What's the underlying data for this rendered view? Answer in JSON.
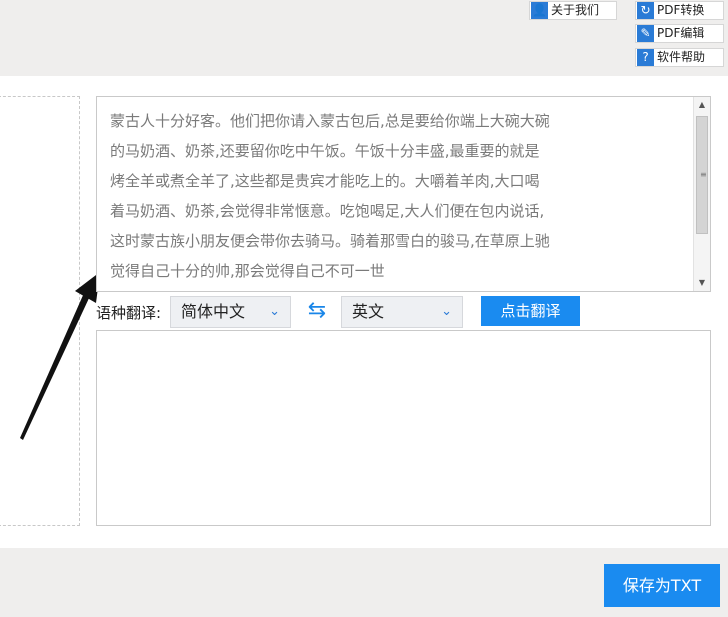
{
  "header": {
    "about": {
      "label": "关于我们",
      "icon": "user-icon"
    },
    "pdf_convert": {
      "label": "PDF转换",
      "icon": "refresh-icon"
    },
    "pdf_edit": {
      "label": "PDF编辑",
      "icon": "pen-icon"
    },
    "help": {
      "label": "软件帮助",
      "icon": "question-icon"
    }
  },
  "source": {
    "lines": [
      "蒙古人十分好客。他们把你请入蒙古包后,总是要给你端上大碗大碗",
      "的马奶酒、奶茶,还要留你吃中午饭。午饭十分丰盛,最重要的就是",
      "烤全羊或煮全羊了,这些都是贵宾才能吃上的。大嚼着羊肉,大口喝",
      "着马奶酒、奶茶,会觉得非常惬意。吃饱喝足,大人们便在包内说话,",
      "这时蒙古族小朋友便会带你去骑马。骑着那雪白的骏马,在草原上驰",
      "觉得自己十分的帅,那会觉得自己不可一世"
    ]
  },
  "translate": {
    "label": "语种翻译:",
    "from_lang": "简体中文",
    "to_lang": "英文",
    "button": "点击翻译"
  },
  "target": {
    "text": ""
  },
  "footer": {
    "save_label": "保存为TXT"
  },
  "colors": {
    "accent": "#1a8bf0",
    "icon_blue": "#2a7bd6"
  }
}
